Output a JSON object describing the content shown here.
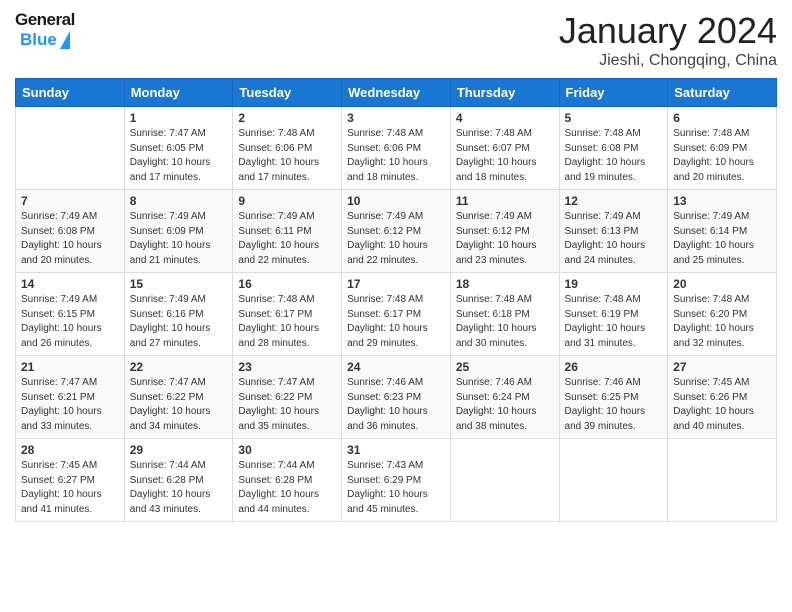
{
  "logo": {
    "text1": "General",
    "text2": "Blue"
  },
  "title": "January 2024",
  "subtitle": "Jieshi, Chongqing, China",
  "days_header": [
    "Sunday",
    "Monday",
    "Tuesday",
    "Wednesday",
    "Thursday",
    "Friday",
    "Saturday"
  ],
  "weeks": [
    [
      {
        "day": "",
        "sunrise": "",
        "sunset": "",
        "daylight": ""
      },
      {
        "day": "1",
        "sunrise": "Sunrise: 7:47 AM",
        "sunset": "Sunset: 6:05 PM",
        "daylight": "Daylight: 10 hours and 17 minutes."
      },
      {
        "day": "2",
        "sunrise": "Sunrise: 7:48 AM",
        "sunset": "Sunset: 6:06 PM",
        "daylight": "Daylight: 10 hours and 17 minutes."
      },
      {
        "day": "3",
        "sunrise": "Sunrise: 7:48 AM",
        "sunset": "Sunset: 6:06 PM",
        "daylight": "Daylight: 10 hours and 18 minutes."
      },
      {
        "day": "4",
        "sunrise": "Sunrise: 7:48 AM",
        "sunset": "Sunset: 6:07 PM",
        "daylight": "Daylight: 10 hours and 18 minutes."
      },
      {
        "day": "5",
        "sunrise": "Sunrise: 7:48 AM",
        "sunset": "Sunset: 6:08 PM",
        "daylight": "Daylight: 10 hours and 19 minutes."
      },
      {
        "day": "6",
        "sunrise": "Sunrise: 7:48 AM",
        "sunset": "Sunset: 6:09 PM",
        "daylight": "Daylight: 10 hours and 20 minutes."
      }
    ],
    [
      {
        "day": "7",
        "sunrise": "Sunrise: 7:49 AM",
        "sunset": "Sunset: 6:08 PM",
        "daylight": "Daylight: 10 hours and 20 minutes."
      },
      {
        "day": "8",
        "sunrise": "Sunrise: 7:49 AM",
        "sunset": "Sunset: 6:09 PM",
        "daylight": "Daylight: 10 hours and 21 minutes."
      },
      {
        "day": "9",
        "sunrise": "Sunrise: 7:49 AM",
        "sunset": "Sunset: 6:11 PM",
        "daylight": "Daylight: 10 hours and 22 minutes."
      },
      {
        "day": "10",
        "sunrise": "Sunrise: 7:49 AM",
        "sunset": "Sunset: 6:12 PM",
        "daylight": "Daylight: 10 hours and 22 minutes."
      },
      {
        "day": "11",
        "sunrise": "Sunrise: 7:49 AM",
        "sunset": "Sunset: 6:12 PM",
        "daylight": "Daylight: 10 hours and 23 minutes."
      },
      {
        "day": "12",
        "sunrise": "Sunrise: 7:49 AM",
        "sunset": "Sunset: 6:13 PM",
        "daylight": "Daylight: 10 hours and 24 minutes."
      },
      {
        "day": "13",
        "sunrise": "Sunrise: 7:49 AM",
        "sunset": "Sunset: 6:14 PM",
        "daylight": "Daylight: 10 hours and 25 minutes."
      }
    ],
    [
      {
        "day": "14",
        "sunrise": "Sunrise: 7:49 AM",
        "sunset": "Sunset: 6:15 PM",
        "daylight": "Daylight: 10 hours and 26 minutes."
      },
      {
        "day": "15",
        "sunrise": "Sunrise: 7:49 AM",
        "sunset": "Sunset: 6:16 PM",
        "daylight": "Daylight: 10 hours and 27 minutes."
      },
      {
        "day": "16",
        "sunrise": "Sunrise: 7:48 AM",
        "sunset": "Sunset: 6:17 PM",
        "daylight": "Daylight: 10 hours and 28 minutes."
      },
      {
        "day": "17",
        "sunrise": "Sunrise: 7:48 AM",
        "sunset": "Sunset: 6:17 PM",
        "daylight": "Daylight: 10 hours and 29 minutes."
      },
      {
        "day": "18",
        "sunrise": "Sunrise: 7:48 AM",
        "sunset": "Sunset: 6:18 PM",
        "daylight": "Daylight: 10 hours and 30 minutes."
      },
      {
        "day": "19",
        "sunrise": "Sunrise: 7:48 AM",
        "sunset": "Sunset: 6:19 PM",
        "daylight": "Daylight: 10 hours and 31 minutes."
      },
      {
        "day": "20",
        "sunrise": "Sunrise: 7:48 AM",
        "sunset": "Sunset: 6:20 PM",
        "daylight": "Daylight: 10 hours and 32 minutes."
      }
    ],
    [
      {
        "day": "21",
        "sunrise": "Sunrise: 7:47 AM",
        "sunset": "Sunset: 6:21 PM",
        "daylight": "Daylight: 10 hours and 33 minutes."
      },
      {
        "day": "22",
        "sunrise": "Sunrise: 7:47 AM",
        "sunset": "Sunset: 6:22 PM",
        "daylight": "Daylight: 10 hours and 34 minutes."
      },
      {
        "day": "23",
        "sunrise": "Sunrise: 7:47 AM",
        "sunset": "Sunset: 6:22 PM",
        "daylight": "Daylight: 10 hours and 35 minutes."
      },
      {
        "day": "24",
        "sunrise": "Sunrise: 7:46 AM",
        "sunset": "Sunset: 6:23 PM",
        "daylight": "Daylight: 10 hours and 36 minutes."
      },
      {
        "day": "25",
        "sunrise": "Sunrise: 7:46 AM",
        "sunset": "Sunset: 6:24 PM",
        "daylight": "Daylight: 10 hours and 38 minutes."
      },
      {
        "day": "26",
        "sunrise": "Sunrise: 7:46 AM",
        "sunset": "Sunset: 6:25 PM",
        "daylight": "Daylight: 10 hours and 39 minutes."
      },
      {
        "day": "27",
        "sunrise": "Sunrise: 7:45 AM",
        "sunset": "Sunset: 6:26 PM",
        "daylight": "Daylight: 10 hours and 40 minutes."
      }
    ],
    [
      {
        "day": "28",
        "sunrise": "Sunrise: 7:45 AM",
        "sunset": "Sunset: 6:27 PM",
        "daylight": "Daylight: 10 hours and 41 minutes."
      },
      {
        "day": "29",
        "sunrise": "Sunrise: 7:44 AM",
        "sunset": "Sunset: 6:28 PM",
        "daylight": "Daylight: 10 hours and 43 minutes."
      },
      {
        "day": "30",
        "sunrise": "Sunrise: 7:44 AM",
        "sunset": "Sunset: 6:28 PM",
        "daylight": "Daylight: 10 hours and 44 minutes."
      },
      {
        "day": "31",
        "sunrise": "Sunrise: 7:43 AM",
        "sunset": "Sunset: 6:29 PM",
        "daylight": "Daylight: 10 hours and 45 minutes."
      },
      {
        "day": "",
        "sunrise": "",
        "sunset": "",
        "daylight": ""
      },
      {
        "day": "",
        "sunrise": "",
        "sunset": "",
        "daylight": ""
      },
      {
        "day": "",
        "sunrise": "",
        "sunset": "",
        "daylight": ""
      }
    ]
  ]
}
